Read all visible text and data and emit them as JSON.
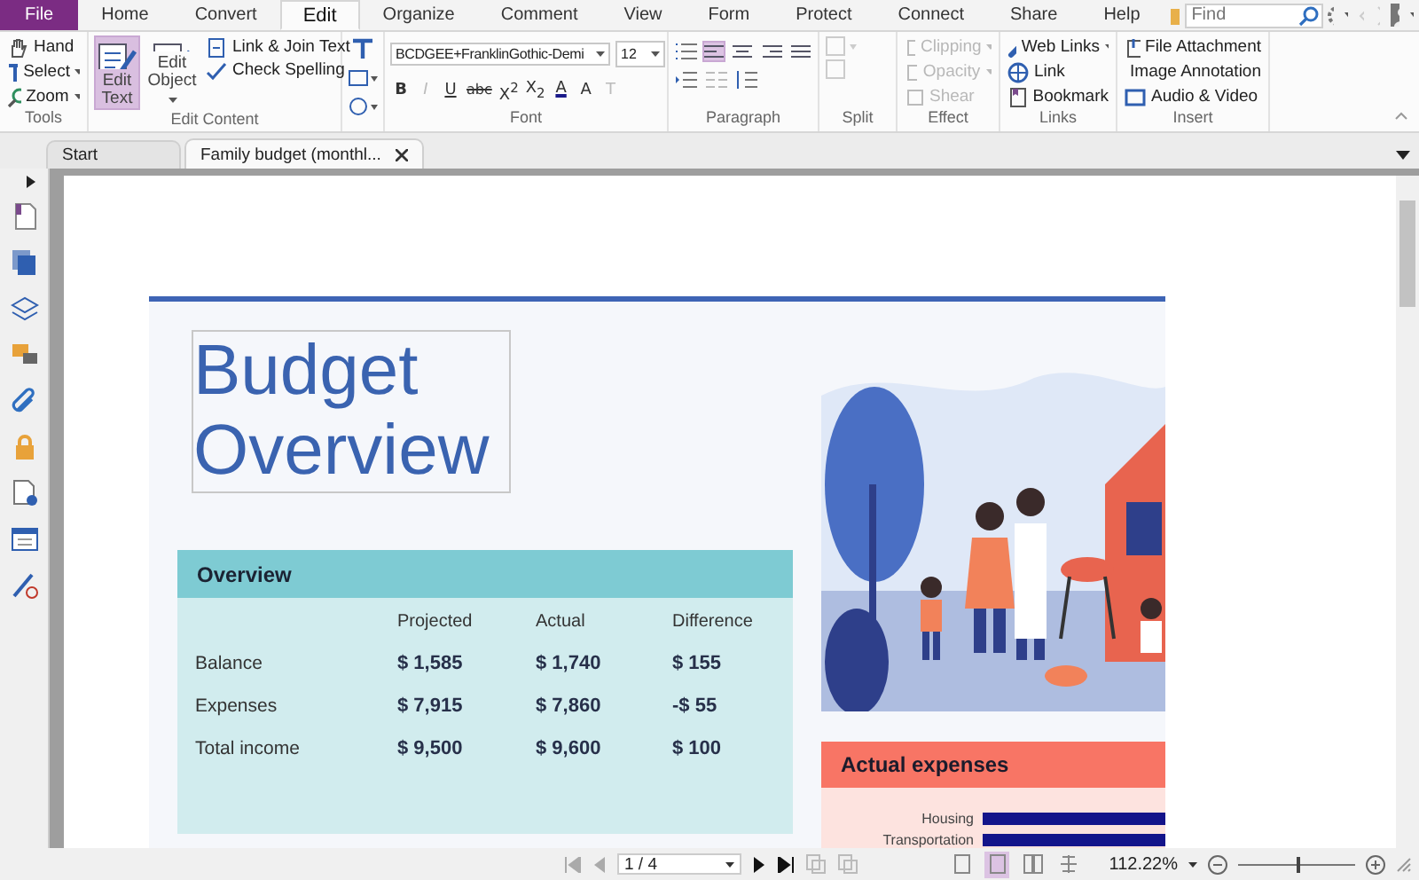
{
  "menu_tabs": [
    {
      "label": "File",
      "kind": "file",
      "selected": false
    },
    {
      "label": "Home",
      "kind": "tab",
      "selected": false
    },
    {
      "label": "Convert",
      "kind": "tab",
      "selected": false
    },
    {
      "label": "Edit",
      "kind": "tab",
      "selected": true
    },
    {
      "label": "Organize",
      "kind": "tab",
      "selected": false
    },
    {
      "label": "Comment",
      "kind": "tab",
      "selected": false
    },
    {
      "label": "View",
      "kind": "tab",
      "selected": false
    },
    {
      "label": "Form",
      "kind": "tab",
      "selected": false
    },
    {
      "label": "Protect",
      "kind": "tab",
      "selected": false
    },
    {
      "label": "Connect",
      "kind": "tab",
      "selected": false
    },
    {
      "label": "Share",
      "kind": "tab",
      "selected": false
    },
    {
      "label": "Help",
      "kind": "tab",
      "selected": false
    }
  ],
  "search": {
    "placeholder": "Find"
  },
  "ribbon": {
    "tools": {
      "label": "Tools",
      "items": [
        {
          "label": "Hand",
          "dropdown": false
        },
        {
          "label": "Select",
          "dropdown": true
        },
        {
          "label": "Zoom",
          "dropdown": true
        }
      ]
    },
    "edit_content": {
      "label": "Edit Content",
      "large_buttons": [
        {
          "label": "Edit Text",
          "selected": true,
          "dropdown": false
        },
        {
          "label": "Edit Object",
          "selected": false,
          "dropdown": true
        }
      ],
      "items": [
        {
          "label": "Link & Join Text"
        },
        {
          "label": "Check Spelling"
        }
      ]
    },
    "font": {
      "label": "Font",
      "font_name": "BCDGEE+FranklinGothic-Demi",
      "font_size": "12",
      "format_buttons": [
        {
          "label": "B",
          "disabled": false
        },
        {
          "label": "I",
          "disabled": true
        },
        {
          "label": "U",
          "disabled": false
        },
        {
          "label": "abc",
          "disabled": false
        },
        {
          "label": "X$^{2}$",
          "disabled": false
        },
        {
          "label": "X$_{2}$",
          "disabled": false
        },
        {
          "label": "A",
          "disabled": false
        },
        {
          "label": "A",
          "disabled": false
        },
        {
          "label": "T",
          "disabled": true
        }
      ]
    },
    "paragraph": {
      "label": "Paragraph",
      "alignments": [
        {
          "selected": true
        },
        {
          "selected": false
        },
        {
          "selected": false
        },
        {
          "selected": false
        }
      ]
    },
    "split": {
      "label": "Split"
    },
    "effect": {
      "label": "Effect",
      "items": [
        {
          "label": "Clipping",
          "disabled": true,
          "dropdown": true
        },
        {
          "label": "Opacity",
          "disabled": true,
          "dropdown": true
        },
        {
          "label": "Shear",
          "disabled": true,
          "dropdown": false
        }
      ]
    },
    "links": {
      "label": "Links",
      "items": [
        {
          "label": "Web Links",
          "dropdown": true
        },
        {
          "label": "Link",
          "dropdown": false
        },
        {
          "label": "Bookmark",
          "dropdown": false
        }
      ]
    },
    "insert": {
      "label": "Insert",
      "items": [
        {
          "label": "File Attachment"
        },
        {
          "label": "Image Annotation"
        },
        {
          "label": "Audio & Video"
        }
      ]
    }
  },
  "doc_tabs": [
    {
      "label": "Start",
      "selected": false,
      "closable": false
    },
    {
      "label": "Family budget (monthl...",
      "selected": true,
      "closable": true
    }
  ],
  "document": {
    "title": "Budget Overview",
    "overview": {
      "title": "Overview",
      "columns": [
        "Projected",
        "Actual",
        "Difference"
      ],
      "rows": [
        {
          "label": "Balance",
          "values": [
            "$ 1,585",
            "$ 1,740",
            "$ 155"
          ]
        },
        {
          "label": "Expenses",
          "values": [
            "$ 7,915",
            "$ 7,860",
            "-$ 55"
          ]
        },
        {
          "label": "Total income",
          "values": [
            "$ 9,500",
            "$ 9,600",
            "$ 100"
          ]
        }
      ]
    },
    "actual_expenses": {
      "title": "Actual expenses",
      "categories": [
        "Housing",
        "Transportation"
      ]
    }
  },
  "status_bar": {
    "page": "1 / 4",
    "view_modes": [
      {
        "selected": false
      },
      {
        "selected": true
      },
      {
        "selected": false
      },
      {
        "selected": false
      }
    ],
    "zoom": "112.22%",
    "zoom_slider": {
      "level": 0.5
    }
  }
}
